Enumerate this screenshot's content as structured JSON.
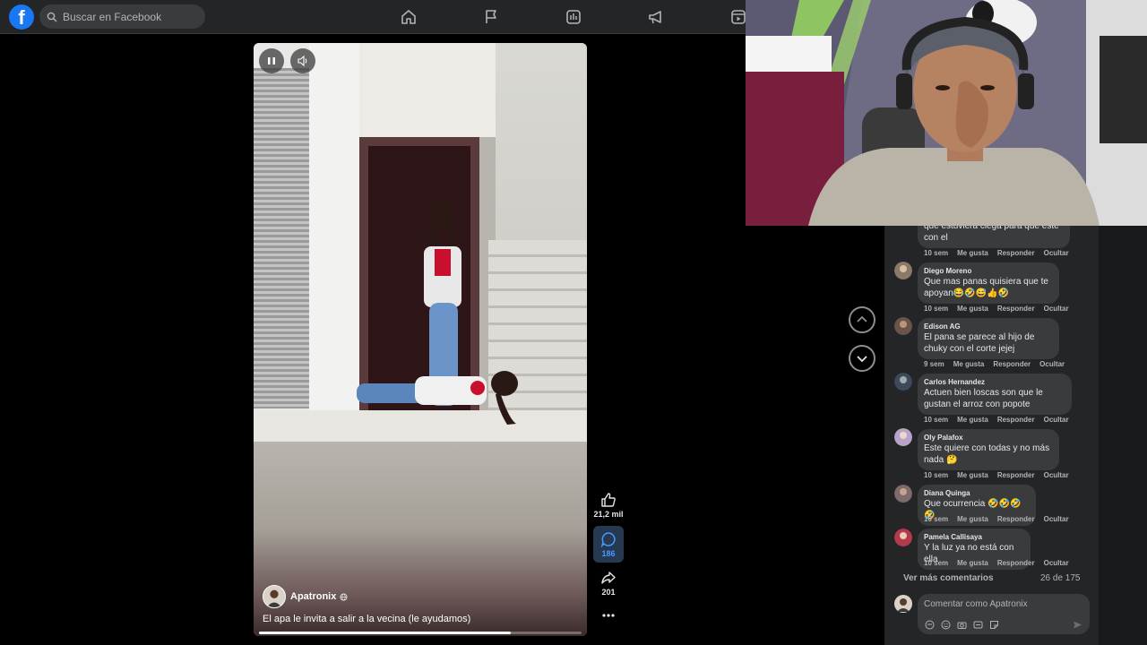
{
  "topbar": {
    "search_placeholder": "Buscar en Facebook",
    "logo_letter": "f",
    "nav_icons": [
      "home-icon",
      "flag-icon",
      "video-icon",
      "megaphone-icon",
      "reels-icon"
    ]
  },
  "video": {
    "author": "Apatronix",
    "caption": "El apa le invita a salir a la vecina (le ayudamos)",
    "progress": 0.78
  },
  "actions": {
    "likes": "21,2 mil",
    "comments": "186",
    "shares": "201"
  },
  "comments": {
    "top_partial": {
      "text": "que estuviera ciega para que este con el",
      "time": "10 sem"
    },
    "items": [
      {
        "name": "Diego Moreno",
        "text": "Que mas panas quisiera que te apoyan😂🤣😅👍🤣",
        "time": "10 sem"
      },
      {
        "name": "Edison AG",
        "text": "El pana se parece al hijo de chuky con el corte jejej",
        "time": "9 sem"
      },
      {
        "name": "Carlos Hernandez",
        "text": "Actuen bien loscas son que le gustan el arroz con popote",
        "time": "10 sem"
      },
      {
        "name": "Oly Palafox",
        "text": "Este quiere con todas y no más nada 🤔",
        "time": "10 sem"
      },
      {
        "name": "Diana Quinga",
        "text": "Que ocurrencia 🤣🤣🤣🤣",
        "time": "10 sem"
      },
      {
        "name": "Pamela Callisaya",
        "text": "Y la luz ya no está con ella",
        "time": "10 sem"
      }
    ],
    "like_label": "Me gusta",
    "reply_label": "Responder",
    "hide_label": "Ocultar",
    "more_label": "Ver más comentarios",
    "pagination": "26 de 175",
    "input_placeholder": "Comentar como Apatronix"
  },
  "colors": {
    "accent": "#1877f2",
    "panel": "#242526",
    "bubble": "#3a3b3c"
  }
}
